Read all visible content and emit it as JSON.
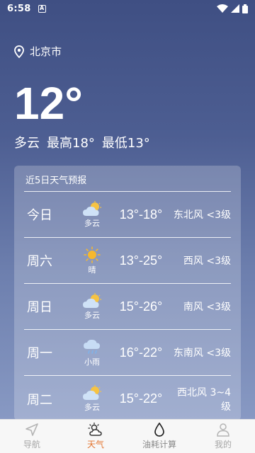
{
  "status": {
    "time": "6:58",
    "notif": "A"
  },
  "location": {
    "city": "北京市"
  },
  "current": {
    "temp": "12°",
    "condition": "多云",
    "high": "最高18°",
    "low": "最低13°"
  },
  "forecast": {
    "title": "近5日天气预报",
    "days": [
      {
        "day": "今日",
        "condition": "多云",
        "icon": "partly-cloudy-icon",
        "temps": "13°-18°",
        "wind": "东北风 <3级"
      },
      {
        "day": "周六",
        "condition": "晴",
        "icon": "sunny-icon",
        "temps": "13°-25°",
        "wind": "西风 <3级"
      },
      {
        "day": "周日",
        "condition": "多云",
        "icon": "partly-cloudy-icon",
        "temps": "15°-26°",
        "wind": "南风 <3级"
      },
      {
        "day": "周一",
        "condition": "小雨",
        "icon": "light-rain-icon",
        "temps": "16°-22°",
        "wind": "东南风 <3级"
      },
      {
        "day": "周二",
        "condition": "多云",
        "icon": "partly-cloudy-icon",
        "temps": "15°-22°",
        "wind": "西北风 3~4级"
      }
    ]
  },
  "nav": {
    "items": [
      {
        "label": "导航",
        "icon": "navigation-arrow-icon"
      },
      {
        "label": "天气",
        "icon": "weather-icon"
      },
      {
        "label": "油耗计算",
        "icon": "fuel-drop-icon"
      },
      {
        "label": "我的",
        "icon": "user-icon"
      }
    ]
  },
  "colors": {
    "accent": "#e3742f",
    "background_top": "#3f4f83",
    "background_bottom": "#8e9fc8"
  }
}
